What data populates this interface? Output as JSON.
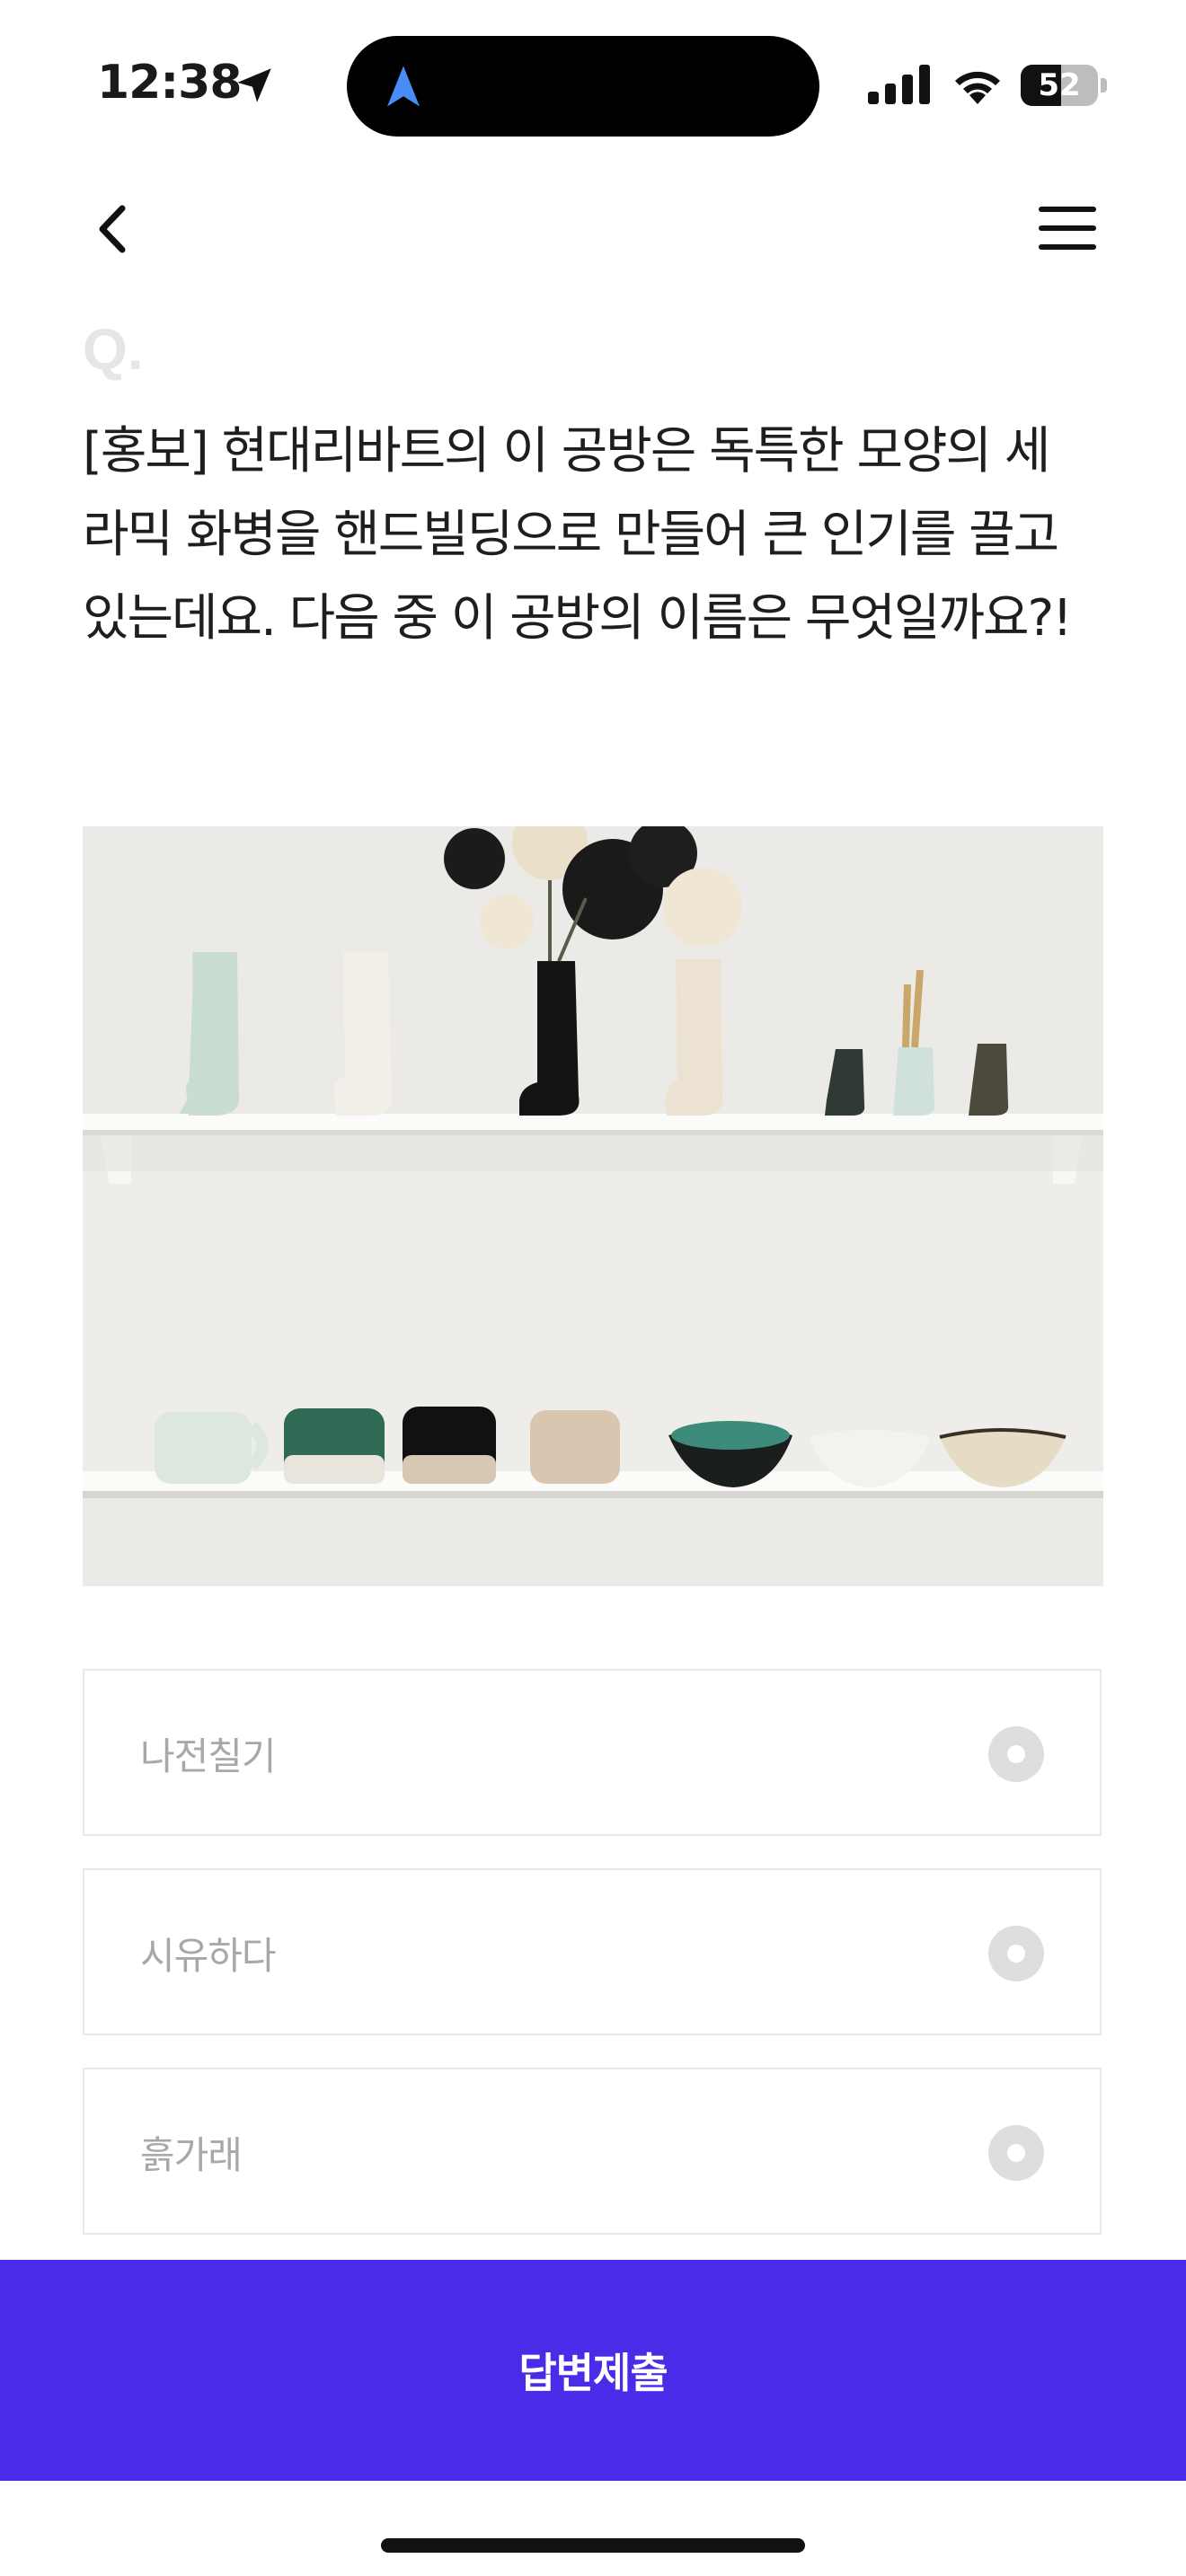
{
  "status_bar": {
    "time": "12:38",
    "battery_level": "52",
    "battery_fraction": 0.52,
    "location_icon": "location-arrow-icon",
    "nav_icon": "navigation-arrow-icon",
    "accent_blue": "#4a8cf7"
  },
  "header": {
    "back_icon": "chevron-left-icon",
    "menu_icon": "hamburger-menu-icon"
  },
  "question": {
    "prefix": "Q.",
    "text": "[홍보] 현대리바트의 이 공방은 독특한 모양의 세라믹 화병을 핸드빌딩으로 만들어 큰 인기를 끌고 있는데요. 다음 중 이 공방의 이름은 무엇일까요?!"
  },
  "options": [
    {
      "label": "나전칠기",
      "selected": false
    },
    {
      "label": "시유하다",
      "selected": false
    },
    {
      "label": "흙가래",
      "selected": false
    }
  ],
  "submit": {
    "label": "답변제출",
    "color": "#4a2be8"
  }
}
